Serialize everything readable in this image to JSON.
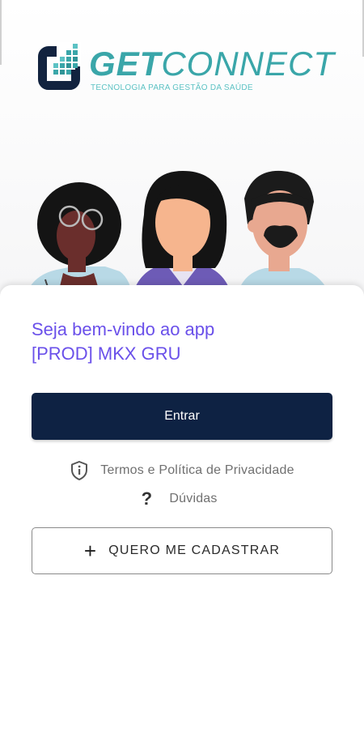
{
  "brand": {
    "name_part1": "GET",
    "name_part2": "CONNECT",
    "tagline": "TECNOLOGIA PARA GESTÃO DA SAÚDE",
    "colors": {
      "teal": "#3aa6a9",
      "teal_light": "#5cc2c4",
      "logo_dark": "#12233f"
    }
  },
  "welcome": {
    "line1": "Seja bem-vindo ao app",
    "line2": "[PROD] MKX GRU"
  },
  "actions": {
    "enter_label": "Entrar",
    "terms_label": "Termos e Política de Privacidade",
    "faq_label": "Dúvidas",
    "register_label": "QUERO ME CADASTRAR"
  },
  "icons": {
    "brand_logo": "getconnect-logo-icon",
    "illustration": "people-illustration",
    "terms": "shield-info-icon",
    "faq": "question-mark-icon",
    "register": "plus-icon"
  },
  "colors": {
    "welcome_text": "#6a50ea",
    "primary_button": "#0e2243",
    "muted_text": "#707070"
  }
}
